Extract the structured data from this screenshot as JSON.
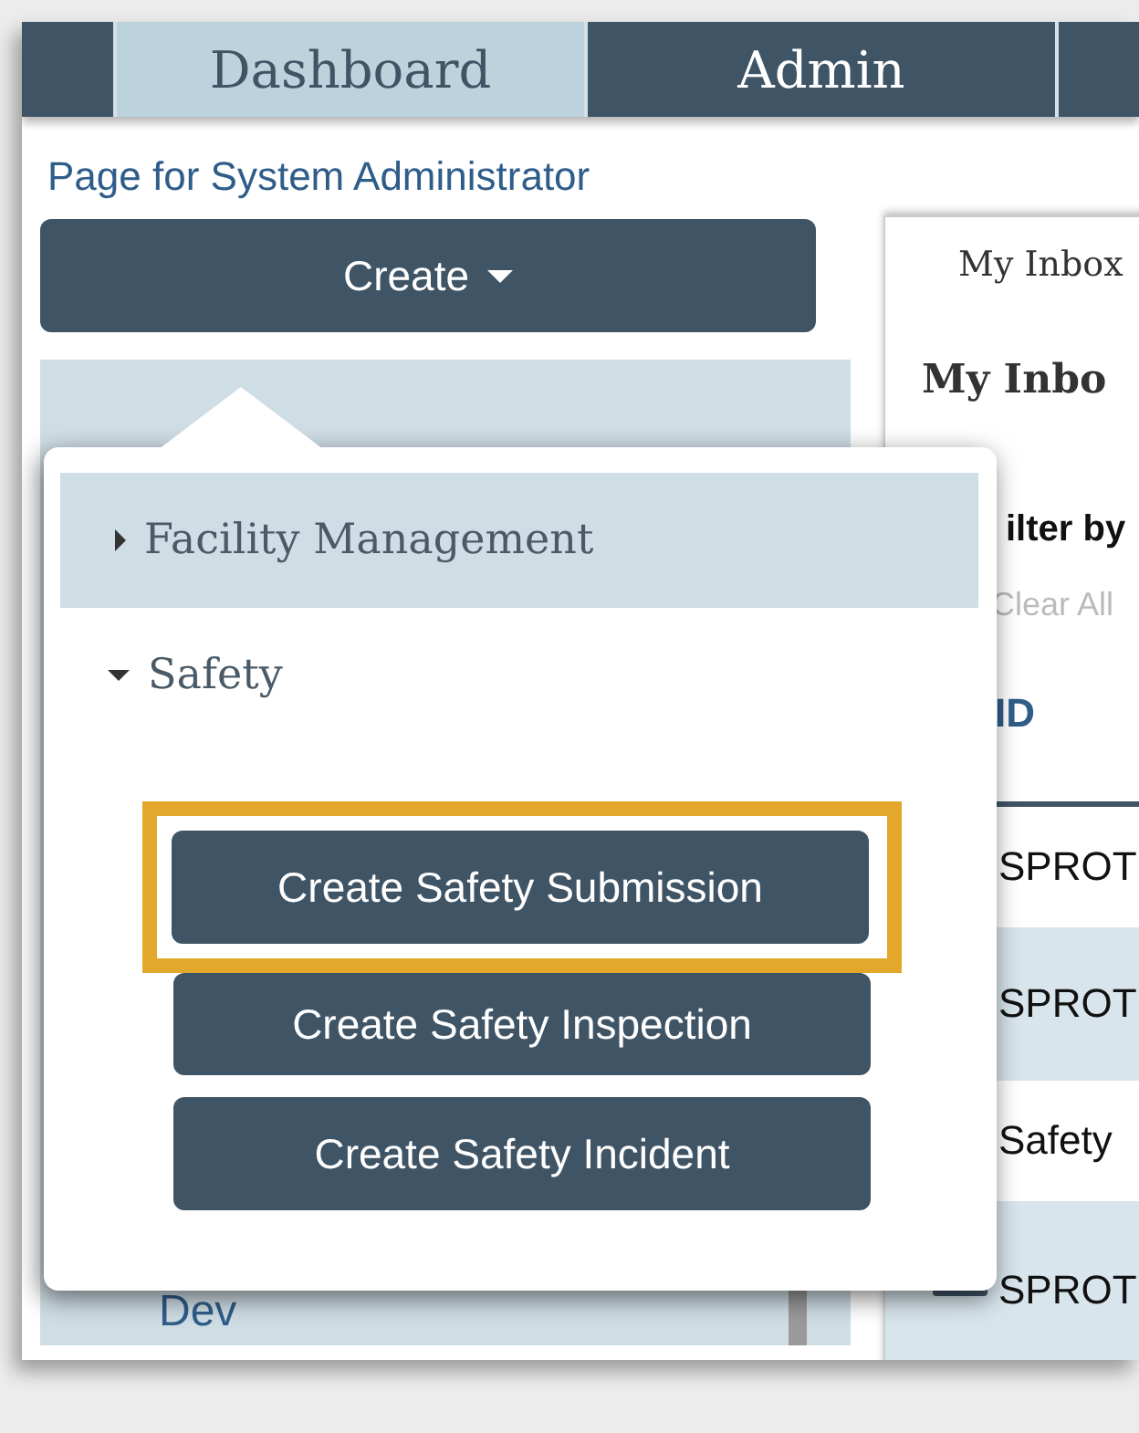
{
  "nav": {
    "tabs": [
      {
        "label": "Dashboard",
        "selected": true
      },
      {
        "label": "Admin",
        "selected": false
      }
    ]
  },
  "page_title": "Page for System Administrator",
  "create_button": {
    "label": "Create"
  },
  "sidebar": {
    "items": [
      {
        "label": "Dev"
      }
    ]
  },
  "create_menu": {
    "categories": [
      {
        "label": "Facility Management",
        "expanded": false,
        "selected": true
      },
      {
        "label": "Safety",
        "expanded": true,
        "selected": false,
        "actions": [
          {
            "label": "Create Safety Submission",
            "highlighted": true
          },
          {
            "label": "Create Safety Inspection",
            "highlighted": false
          },
          {
            "label": "Create Safety Incident",
            "highlighted": false
          }
        ]
      }
    ]
  },
  "inbox": {
    "tab": "My Inbox",
    "heading": "My Inbo",
    "filter_label": "ilter by",
    "clear": "Clear All",
    "columns": [
      "ID"
    ],
    "rows": [
      {
        "cells": [
          "SPROT"
        ]
      },
      {
        "cells": [
          "SPROT"
        ]
      },
      {
        "cells": [
          "Safety"
        ]
      },
      {
        "cells": [
          "SPROT"
        ],
        "has_icon": true
      }
    ]
  }
}
